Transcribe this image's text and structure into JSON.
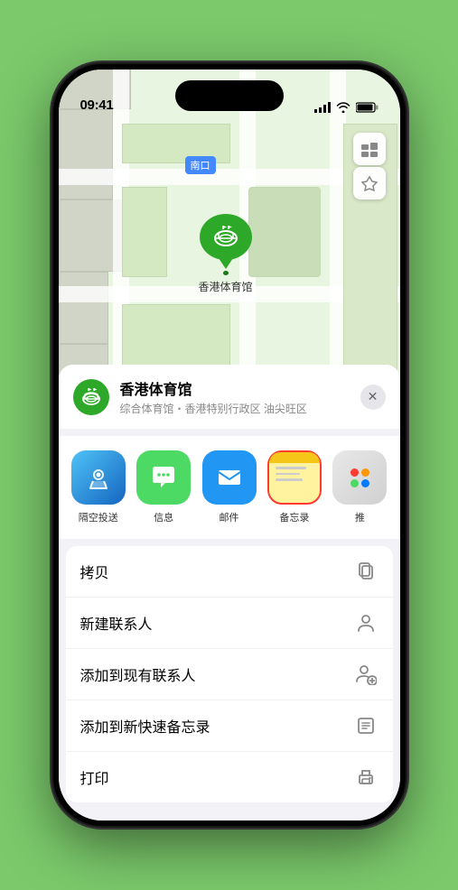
{
  "statusBar": {
    "time": "09:41",
    "signal": "●●●●",
    "wifi": "wifi",
    "battery": "battery"
  },
  "map": {
    "locationLabel": "南口",
    "markerLabel": "香港体育馆",
    "markerEmoji": "🏟"
  },
  "mapControls": {
    "mapViewIcon": "🗺",
    "locationIcon": "↗"
  },
  "venueCard": {
    "name": "香港体育馆",
    "subtext": "综合体育馆・香港特别行政区 油尖旺区",
    "closeLabel": "✕"
  },
  "shareRow": {
    "items": [
      {
        "id": "airdrop",
        "label": "隔空投送",
        "type": "airdrop"
      },
      {
        "id": "messages",
        "label": "信息",
        "type": "messages"
      },
      {
        "id": "mail",
        "label": "邮件",
        "type": "mail"
      },
      {
        "id": "notes",
        "label": "备忘录",
        "type": "notes"
      },
      {
        "id": "more",
        "label": "推",
        "type": "more"
      }
    ]
  },
  "actionList": {
    "items": [
      {
        "id": "copy",
        "label": "拷贝",
        "icon": "copy"
      },
      {
        "id": "new-contact",
        "label": "新建联系人",
        "icon": "person"
      },
      {
        "id": "add-existing",
        "label": "添加到现有联系人",
        "icon": "person-add"
      },
      {
        "id": "add-notes",
        "label": "添加到新快速备忘录",
        "icon": "notes"
      },
      {
        "id": "print",
        "label": "打印",
        "icon": "printer"
      }
    ]
  }
}
